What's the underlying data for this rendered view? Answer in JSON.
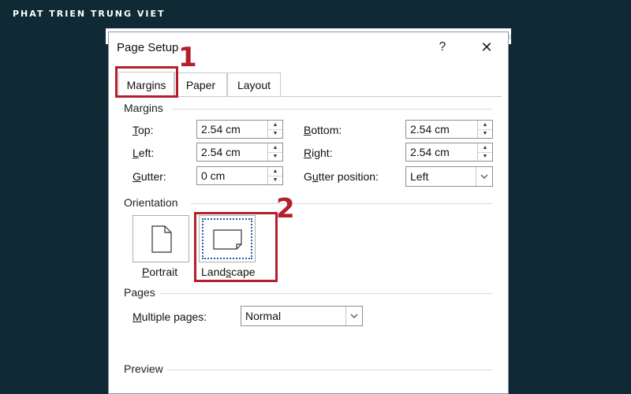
{
  "brand": "PHAT TRIEN TRUNG VIET",
  "dialog": {
    "title": "Page Setup",
    "help_label": "?",
    "close_label": "✕"
  },
  "tabs": [
    {
      "label": "Margins",
      "active": true
    },
    {
      "label": "Paper",
      "active": false
    },
    {
      "label": "Layout",
      "active": false
    }
  ],
  "annotations": {
    "step1": "1",
    "step2": "2",
    "color": "#b3202b"
  },
  "margins": {
    "section_title": "Margins",
    "top": {
      "mn": "T",
      "rest": "op:",
      "value": "2.54 cm"
    },
    "bottom": {
      "mn": "B",
      "rest": "ottom:",
      "value": "2.54 cm"
    },
    "left": {
      "mn": "L",
      "rest": "eft:",
      "value": "2.54 cm"
    },
    "right": {
      "mn": "R",
      "rest": "ight:",
      "value": "2.54 cm"
    },
    "gutter": {
      "mn": "G",
      "rest": "utter:",
      "value": "0 cm"
    },
    "gutter_position": {
      "pre": "G",
      "mn": "u",
      "rest": "tter position:",
      "value": "Left"
    }
  },
  "orientation": {
    "section_title": "Orientation",
    "portrait": {
      "mn": "P",
      "rest": "ortrait"
    },
    "landscape": {
      "pre": "Land",
      "mn": "s",
      "rest": "cape"
    }
  },
  "pages": {
    "section_title": "Pages",
    "multiple_pages": {
      "mn": "M",
      "rest": "ultiple pages:",
      "value": "Normal"
    }
  },
  "preview": {
    "section_title": "Preview"
  }
}
